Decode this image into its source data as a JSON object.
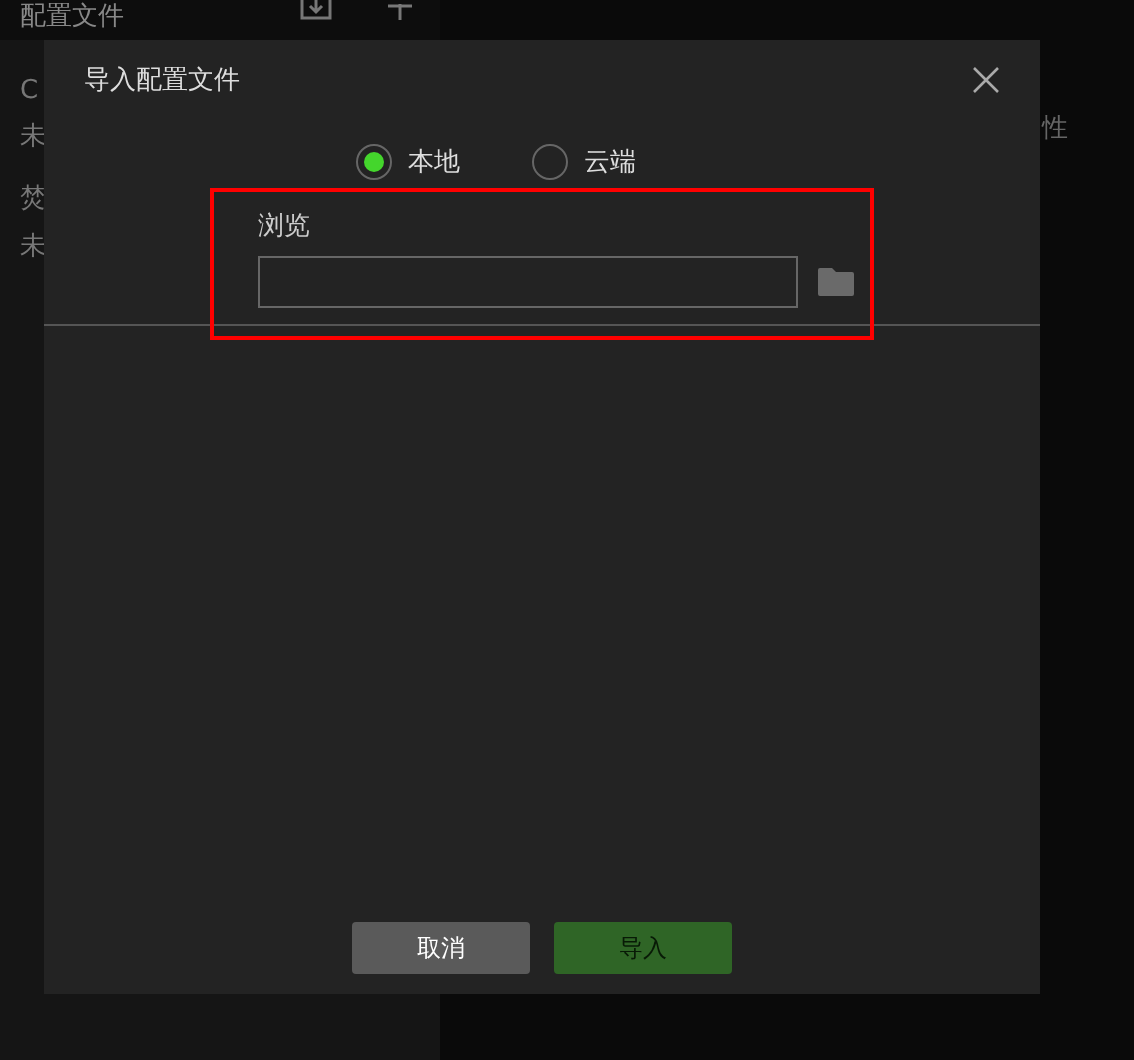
{
  "background": {
    "sidebar_title": "配置文件",
    "items": [
      {
        "name": "C",
        "status": "未"
      },
      {
        "name": "焚",
        "status": "未"
      }
    ],
    "side_text": "性"
  },
  "dialog": {
    "title": "导入配置文件",
    "source_options": [
      {
        "label": "本地",
        "selected": true
      },
      {
        "label": "云端",
        "selected": false
      }
    ],
    "browse": {
      "label": "浏览",
      "highlighted": true
    },
    "buttons": [
      {
        "label": "取消",
        "kind": "cancel",
        "disabled": false
      },
      {
        "label": "导入",
        "kind": "confirm",
        "disabled": true
      }
    ]
  }
}
